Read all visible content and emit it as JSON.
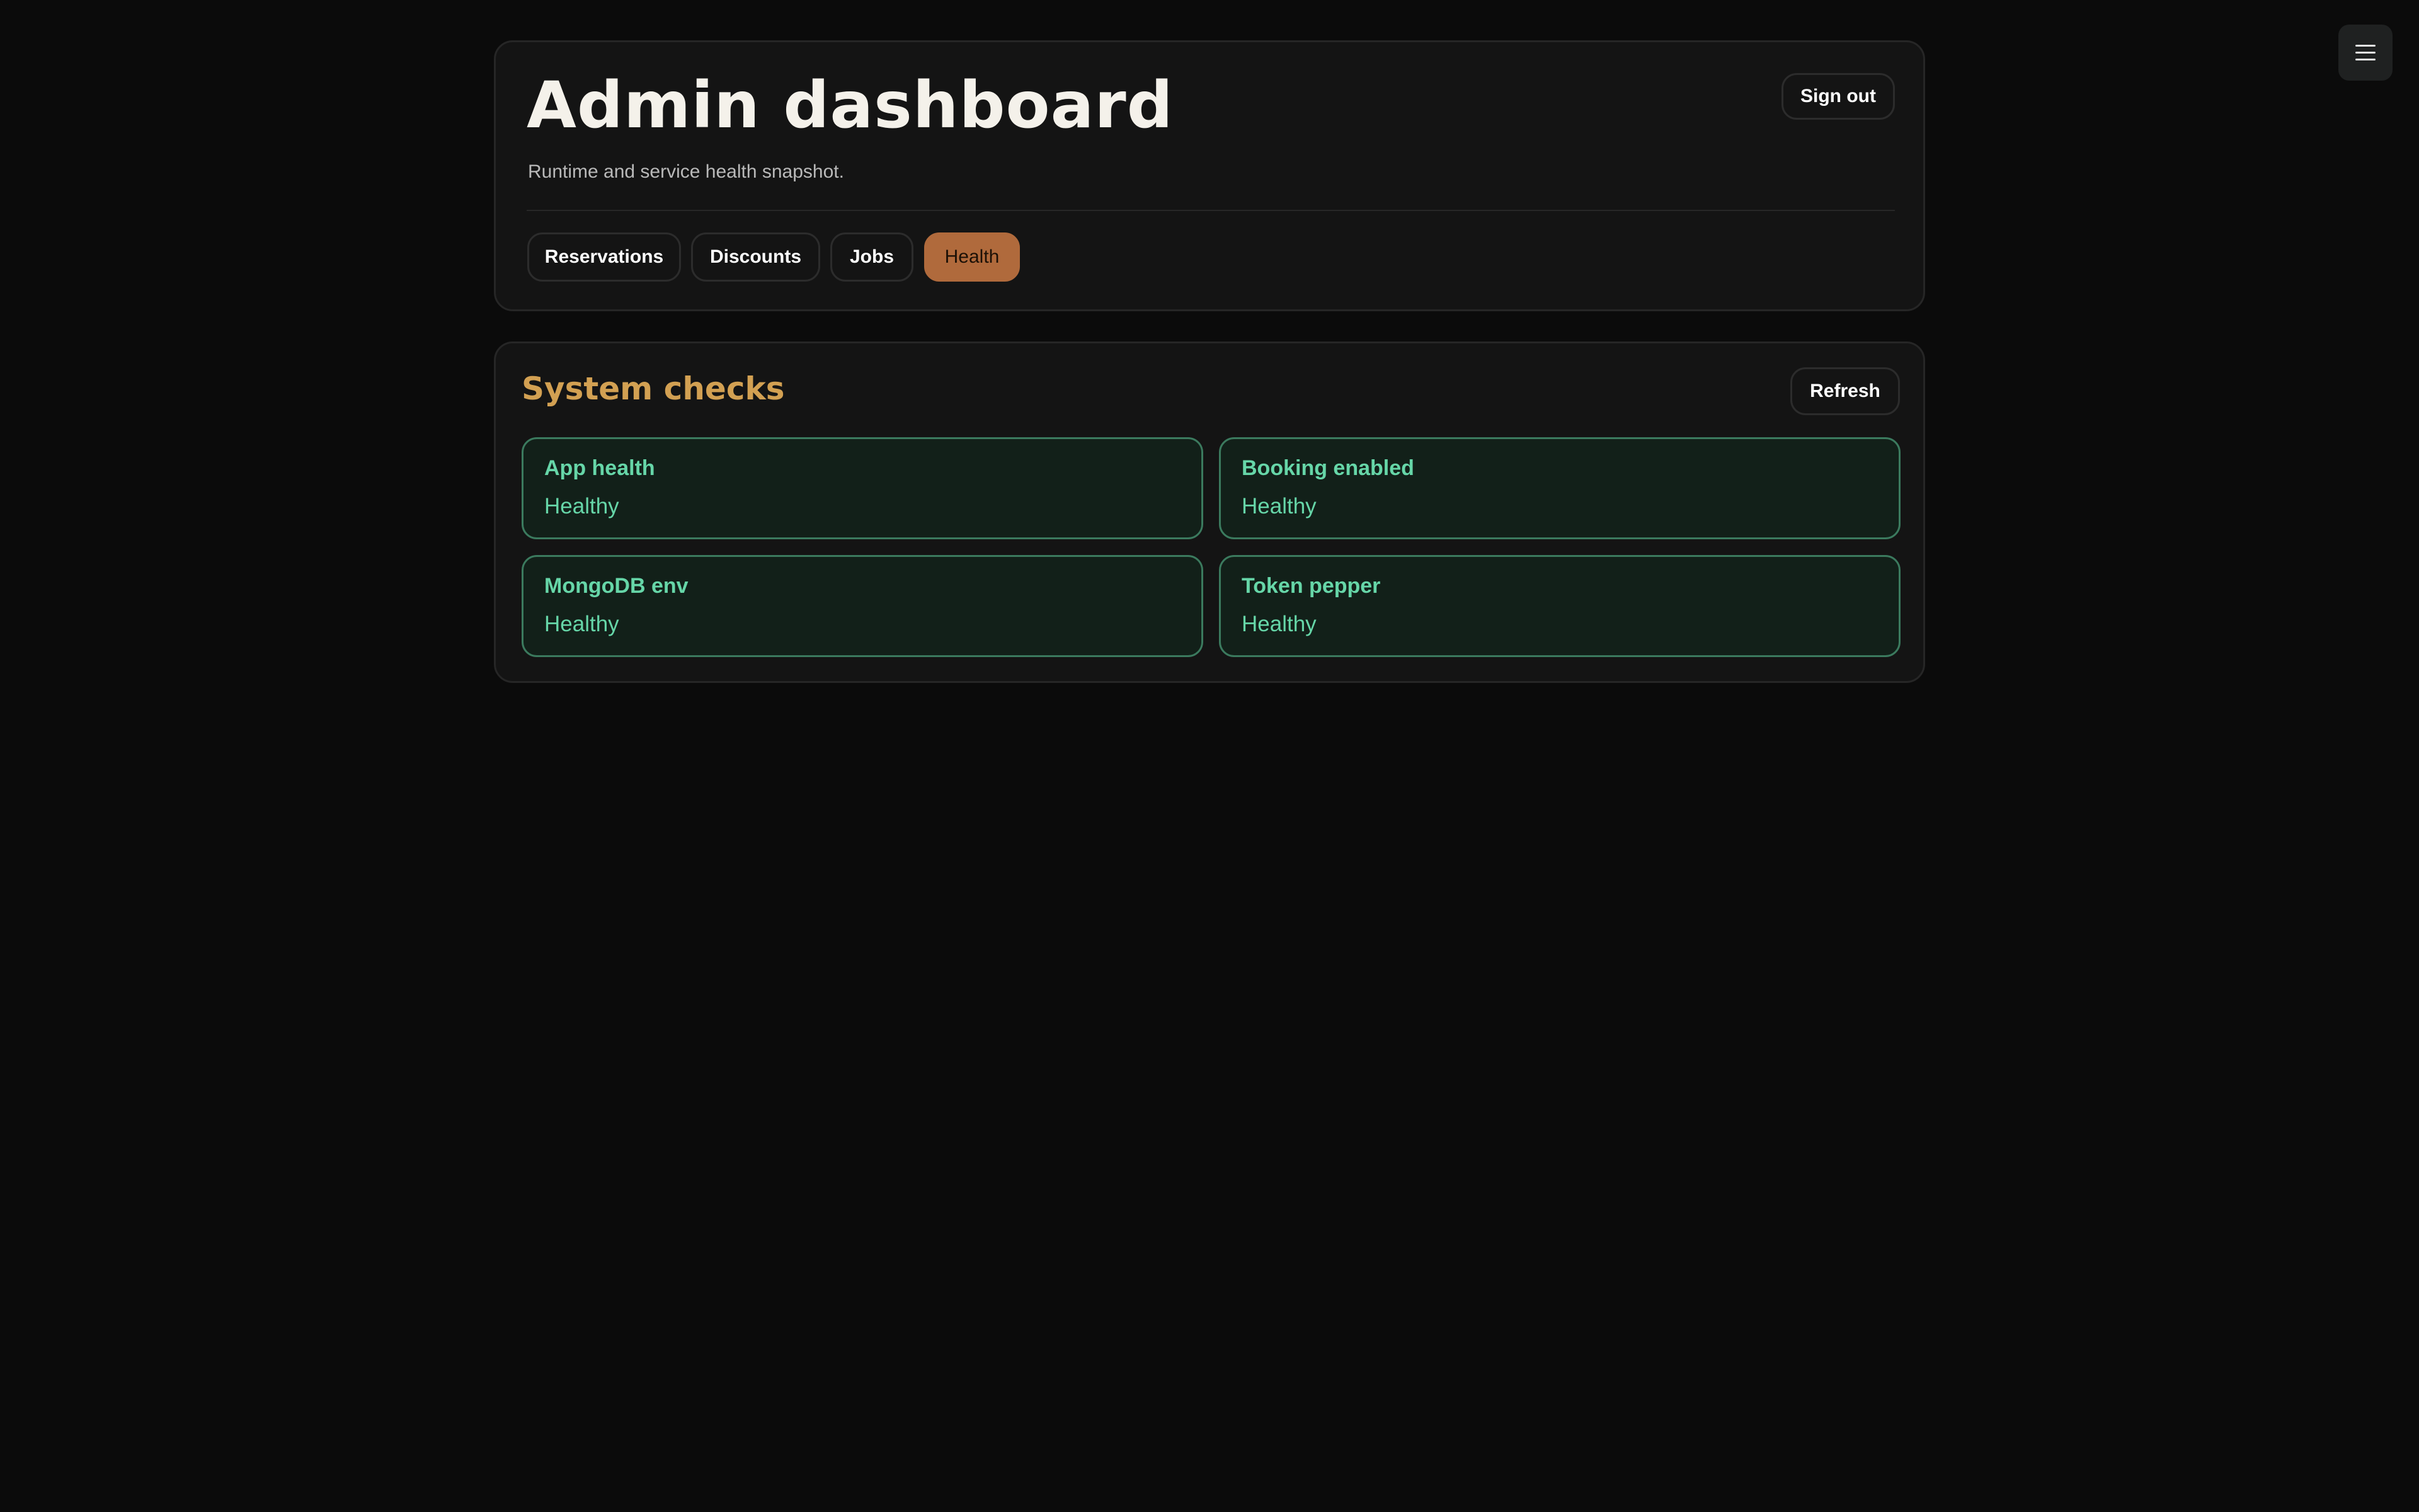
{
  "header": {
    "title": "Admin dashboard",
    "subtitle": "Runtime and service health snapshot.",
    "sign_out_label": "Sign out"
  },
  "menu": {
    "icon": "hamburger-menu-icon"
  },
  "tabs": [
    {
      "label": "Reservations",
      "active": false
    },
    {
      "label": "Discounts",
      "active": false
    },
    {
      "label": "Jobs",
      "active": false
    },
    {
      "label": "Health",
      "active": true
    }
  ],
  "health": {
    "title": "System checks",
    "refresh_label": "Refresh",
    "checks": [
      {
        "name": "App health",
        "status": "Healthy"
      },
      {
        "name": "Booking enabled",
        "status": "Healthy"
      },
      {
        "name": "MongoDB env",
        "status": "Healthy"
      },
      {
        "name": "Token pepper",
        "status": "Healthy"
      }
    ]
  },
  "colors": {
    "background": "#0b0b0b",
    "active_tab": "#b06a3c",
    "section_title": "#d2a052",
    "healthy_text": "#66d6a8",
    "healthy_border": "#3b7a5e",
    "healthy_bg": "#122019"
  }
}
